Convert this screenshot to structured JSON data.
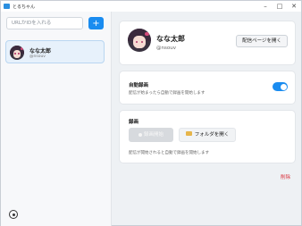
{
  "window": {
    "title": "とるちゃん"
  },
  "sidebar": {
    "url_placeholder": "URLかIDを入れる",
    "add_label": "+",
    "channels": [
      {
        "name": "なな太郎",
        "handle": "@nsouv"
      }
    ]
  },
  "profile": {
    "name": "なな太郎",
    "handle": "@nsouv",
    "stream_page_label": "配信ページを開く"
  },
  "auto_record": {
    "title": "自動録画",
    "description": "配信が始まったら自動で録画を開始します",
    "enabled": true
  },
  "recording": {
    "title": "録画",
    "record_label": "録画開始",
    "folder_label": "フォルダを開く",
    "description": "配信が開始されると自動で録画を開始します"
  },
  "delete_label": "削除",
  "colors": {
    "accent": "#1a8cf0",
    "danger": "#d9303a"
  }
}
